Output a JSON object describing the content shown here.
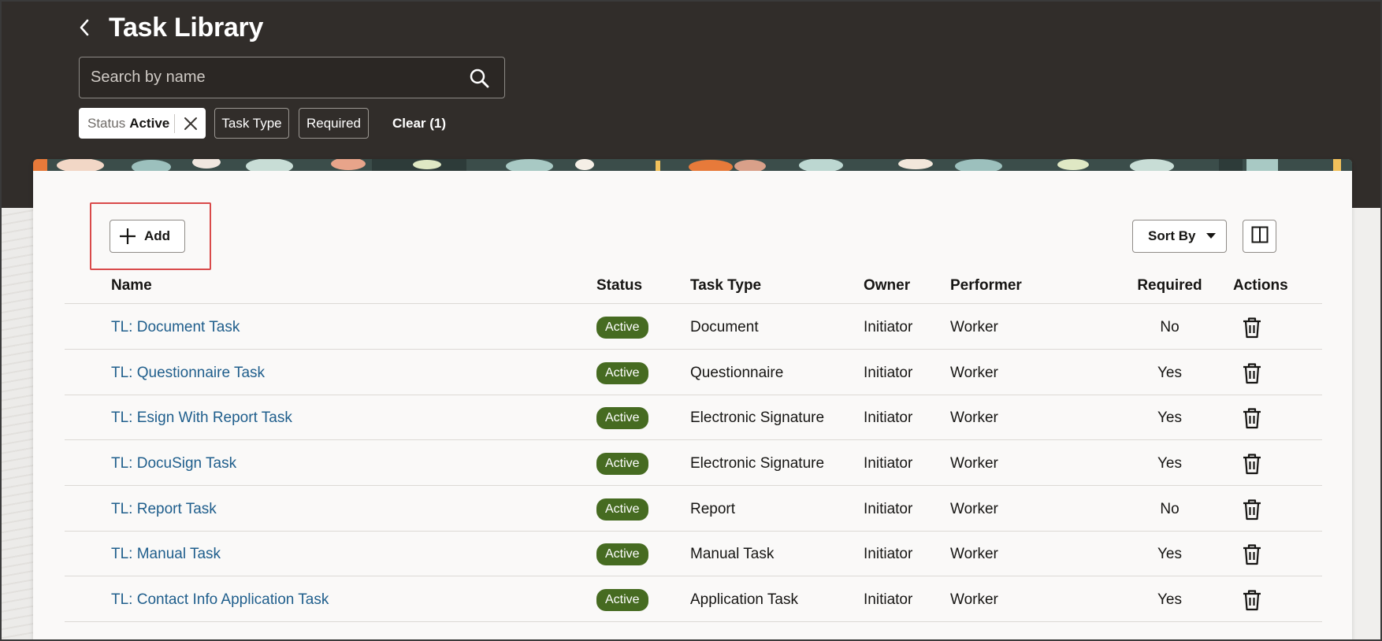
{
  "header": {
    "title": "Task Library",
    "search_placeholder": "Search by name"
  },
  "filters": {
    "status": {
      "label": "Status",
      "value": "Active"
    },
    "task_type": "Task Type",
    "required": "Required",
    "clear": "Clear (1)"
  },
  "toolbar": {
    "add_label": "Add",
    "sort_label": "Sort By"
  },
  "table": {
    "columns": [
      "Name",
      "Status",
      "Task Type",
      "Owner",
      "Performer",
      "Required",
      "Actions"
    ],
    "rows": [
      {
        "name": "TL: Document Task",
        "status": "Active",
        "type": "Document",
        "owner": "Initiator",
        "performer": "Worker",
        "required": "No"
      },
      {
        "name": "TL: Questionnaire Task",
        "status": "Active",
        "type": "Questionnaire",
        "owner": "Initiator",
        "performer": "Worker",
        "required": "Yes"
      },
      {
        "name": "TL: Esign With Report Task",
        "status": "Active",
        "type": "Electronic Signature",
        "owner": "Initiator",
        "performer": "Worker",
        "required": "Yes"
      },
      {
        "name": "TL: DocuSign Task",
        "status": "Active",
        "type": "Electronic Signature",
        "owner": "Initiator",
        "performer": "Worker",
        "required": "Yes"
      },
      {
        "name": "TL: Report Task",
        "status": "Active",
        "type": "Report",
        "owner": "Initiator",
        "performer": "Worker",
        "required": "No"
      },
      {
        "name": "TL: Manual Task",
        "status": "Active",
        "type": "Manual Task",
        "owner": "Initiator",
        "performer": "Worker",
        "required": "Yes"
      },
      {
        "name": "TL: Contact Info Application Task",
        "status": "Active",
        "type": "Application Task",
        "owner": "Initiator",
        "performer": "Worker",
        "required": "Yes"
      }
    ]
  },
  "colors": {
    "header_bg": "#312d2a",
    "link": "#1f5e8c",
    "badge_active": "#466b21",
    "highlight": "#d94a4a"
  },
  "icons": {
    "back": "chevron-left-icon",
    "search": "search-icon",
    "remove": "close-icon",
    "add": "plus-icon",
    "sort": "caret-down-icon",
    "layout": "split-panel-icon",
    "delete": "trash-icon"
  }
}
